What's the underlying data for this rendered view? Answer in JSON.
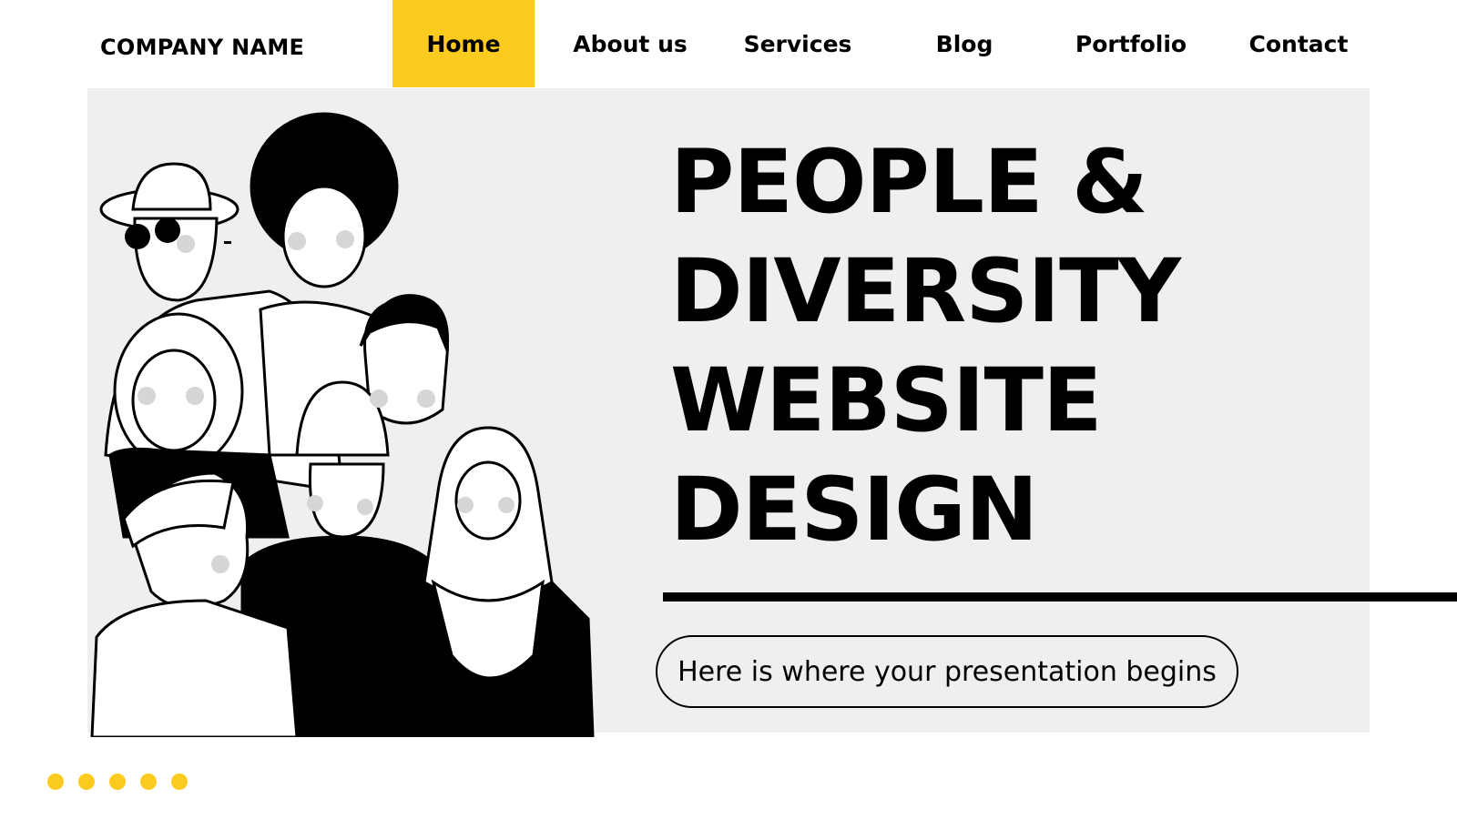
{
  "header": {
    "brand": "COMPANY NAME",
    "nav": [
      {
        "label": "Home",
        "active": true
      },
      {
        "label": "About us",
        "active": false
      },
      {
        "label": "Services",
        "active": false
      },
      {
        "label": "Blog",
        "active": false
      },
      {
        "label": "Portfolio",
        "active": false
      },
      {
        "label": "Contact",
        "active": false
      }
    ]
  },
  "hero": {
    "title_lines": [
      "PEOPLE &",
      "DIVERSITY",
      "WEBSITE",
      "DESIGN"
    ],
    "subtitle": "Here is where your presentation begins",
    "illustration": "diverse-people-group-line-drawing"
  },
  "pagination_dots": 5,
  "colors": {
    "accent": "#fdca1f",
    "panel": "#efefef",
    "text": "#000000"
  }
}
